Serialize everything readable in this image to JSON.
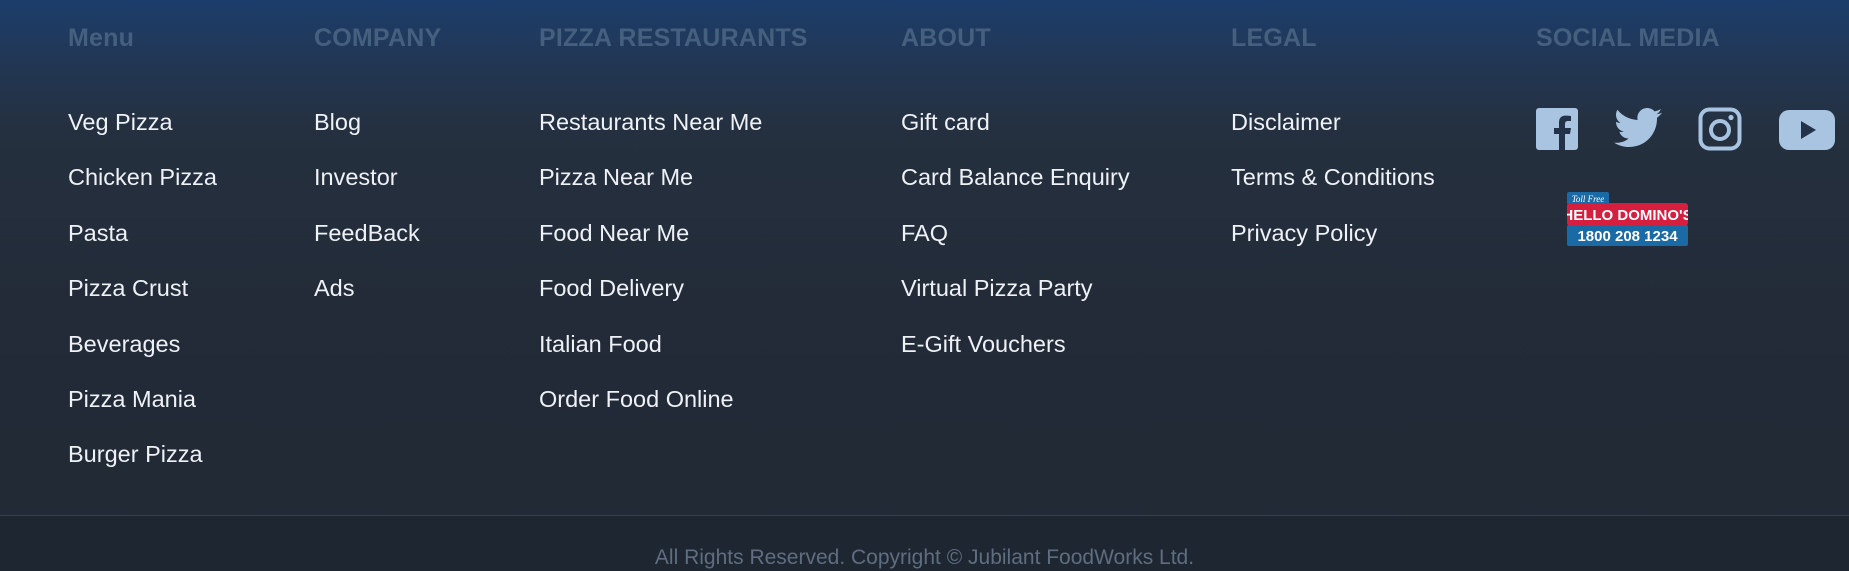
{
  "columns": [
    {
      "title": "Menu",
      "links": [
        "Veg Pizza",
        "Chicken Pizza",
        "Pasta",
        "Pizza Crust",
        "Beverages",
        "Pizza Mania",
        "Burger Pizza"
      ]
    },
    {
      "title": "COMPANY",
      "links": [
        "Blog",
        "Investor",
        "FeedBack",
        "Ads"
      ]
    },
    {
      "title": "PIZZA RESTAURANTS",
      "links": [
        "Restaurants Near Me",
        "Pizza Near Me",
        "Food Near Me",
        "Food Delivery",
        "Italian Food",
        "Order Food Online"
      ]
    },
    {
      "title": "ABOUT",
      "links": [
        "Gift card",
        "Card Balance Enquiry",
        "FAQ",
        "Virtual Pizza Party",
        "E-Gift Vouchers"
      ]
    },
    {
      "title": "LEGAL",
      "links": [
        "Disclaimer",
        "Terms & Conditions",
        "Privacy Policy"
      ]
    },
    {
      "title": "SOCIAL MEDIA"
    }
  ],
  "social": {
    "icons": [
      "facebook-icon",
      "twitter-icon",
      "instagram-icon",
      "youtube-icon"
    ],
    "icon_color": "#a9c4e0"
  },
  "hello_dominos": {
    "toll_free": "Toll Free",
    "brand": "HELLO DOMINO'S",
    "number": "1800 208 1234",
    "colors": {
      "red": "#d61f3f",
      "blue": "#1a6aa6"
    }
  },
  "copyright": "All Rights Reserved. Copyright © Jubilant FoodWorks Ltd."
}
